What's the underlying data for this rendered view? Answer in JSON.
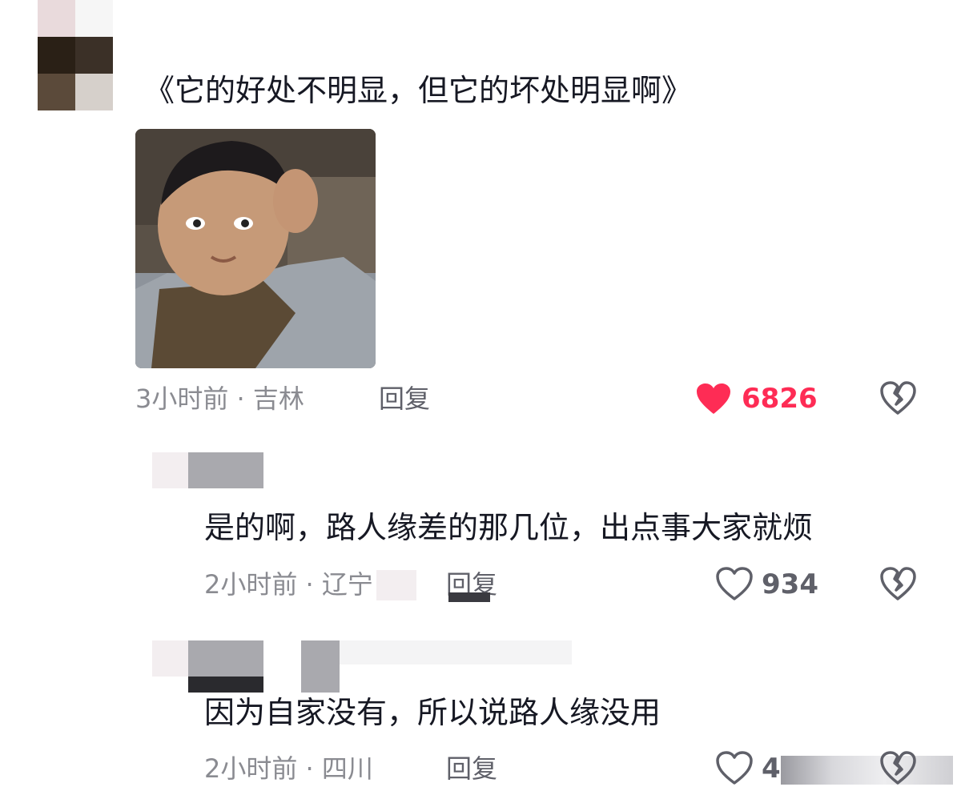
{
  "main_comment": {
    "text": "《它的好处不明显，但它的坏处明显啊》",
    "meta": "3小时前 · 吉林",
    "reply_label": "回复",
    "likes": "6826",
    "liked": true
  },
  "replies": [
    {
      "text": "是的啊，路人缘差的那几位，出点事大家就烦",
      "meta": "2小时前 · 辽宁",
      "reply_label": "回复",
      "likes": "934"
    },
    {
      "text": "因为自家没有，所以说路人缘没用",
      "meta": "2小时前 · 四川",
      "reply_label": "回复",
      "likes": "4"
    }
  ],
  "colors": {
    "like_active": "#fe2c55",
    "text_primary": "#161823",
    "text_meta": "#8a8b91",
    "icon_gray": "#5f6069"
  },
  "icons": [
    "heart-filled-icon",
    "heart-outline-icon",
    "broken-heart-icon"
  ]
}
